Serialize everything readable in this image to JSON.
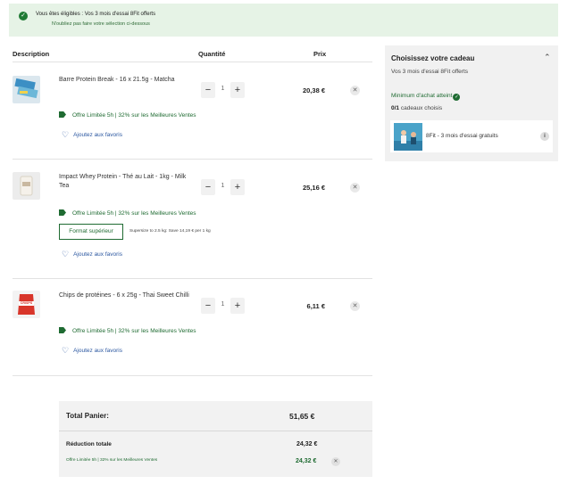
{
  "banner": {
    "line1": "Vous êtes éligibles : Vos 3 mois d'essai 8Fit offerts",
    "line2": "N'oubliez pas faire votre sélection ci-dessous"
  },
  "table": {
    "col_description": "Description",
    "col_quantity": "Quantité",
    "col_price": "Prix"
  },
  "products": [
    {
      "name": "Barre Protein Break - 16 x 21.5g - Matcha",
      "qty": "1",
      "price": "20,38 €",
      "offer": "Offre Limitée 5h | 32% sur les Meilleures Ventes",
      "favorite": "Ajoutez aux favoris"
    },
    {
      "name": "Impact Whey Protein - Thé au Lait - 1kg - Milk Tea",
      "qty": "1",
      "price": "25,16 €",
      "offer": "Offre Limitée 5h | 32% sur les Meilleures Ventes",
      "format_button": "Format supérieur",
      "format_note": "Supersize to 2.5 kg: Save 14,19 € per 1 kg",
      "favorite": "Ajoutez aux favoris"
    },
    {
      "name": "Chips de protéines - 6 x 25g - Thai Sweet Chilli",
      "qty": "1",
      "price": "6,11 €",
      "offer": "Offre Limitée 5h | 32% sur les Meilleures Ventes",
      "favorite": "Ajoutez aux favoris",
      "image_text": "CRISPS"
    }
  ],
  "totals": {
    "total_label": "Total Panier:",
    "total_value": "51,65 €",
    "reduction_label": "Réduction totale",
    "reduction_value": "24,32 €",
    "discount_label": "Offre Limitée 5h | 32% sur les Meilleures Ventes",
    "discount_value": "24,32 €"
  },
  "gift": {
    "title": "Choisissez votre cadeau",
    "subtitle": "Vos 3 mois d'essai 8Fit offerts",
    "minimum": "Minimum d'achat atteint",
    "count_strong": "0/1",
    "count_rest": " cadeaux choisis",
    "item_name": "8Fit - 3 mois d'essai gratuits"
  },
  "icons": {
    "check": "check-circle-icon",
    "tag": "tag-icon",
    "heart": "heart-outline-icon",
    "close": "close-icon",
    "chevron": "chevron-up-icon",
    "info": "info-icon"
  },
  "colors": {
    "accent_green": "#1f6b32",
    "banner_bg": "#e6f3e6",
    "link_blue": "#2b57a0",
    "panel_bg": "#f1f1f1"
  }
}
